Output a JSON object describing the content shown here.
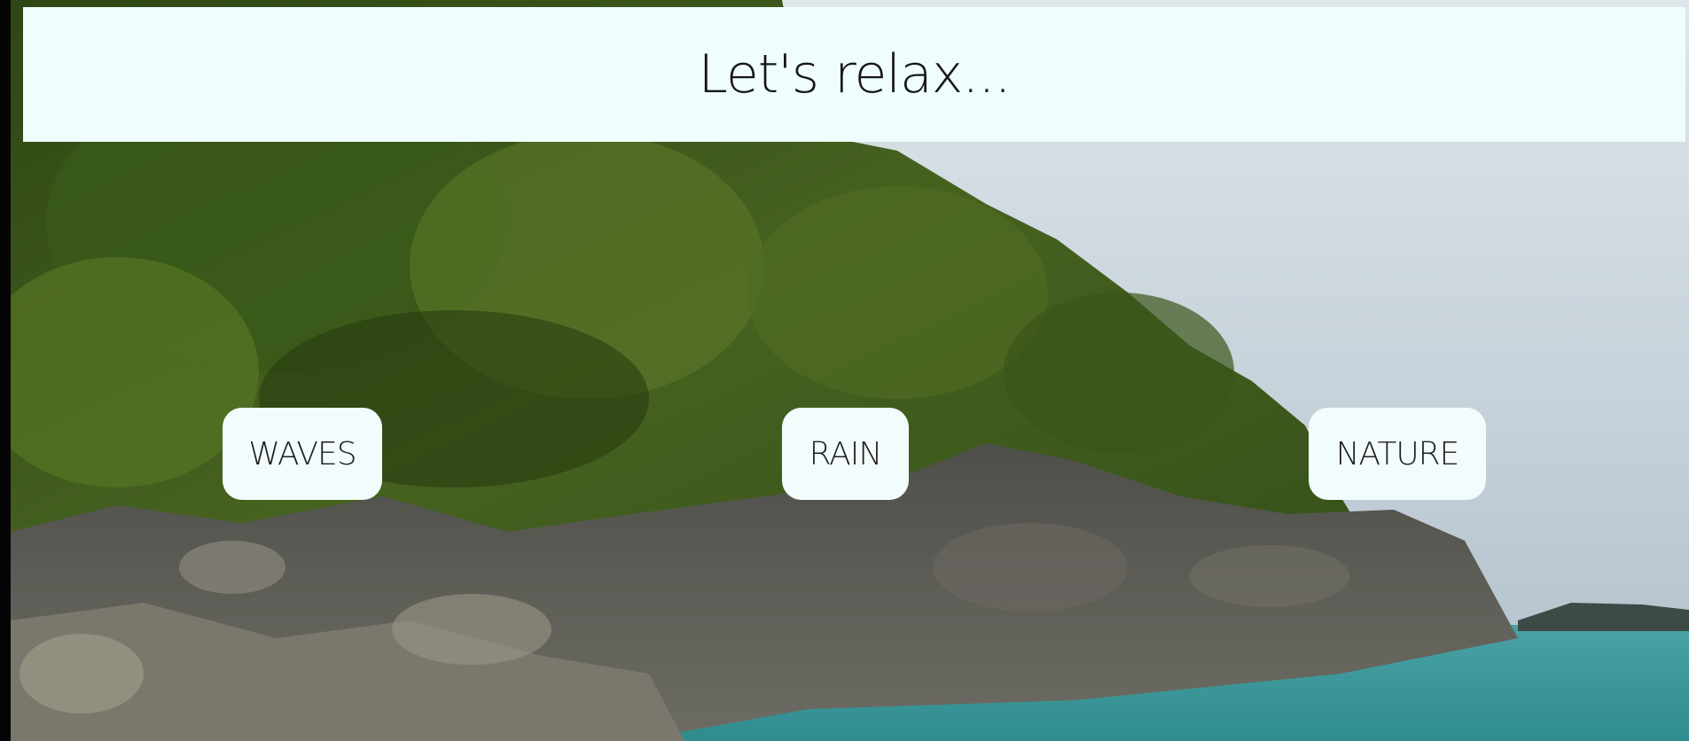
{
  "page": {
    "title": "Let's relax..."
  },
  "buttons": [
    {
      "label": "WAVES",
      "sound": "waves"
    },
    {
      "label": "RAIN",
      "sound": "rain"
    },
    {
      "label": "NATURE",
      "sound": "nature"
    }
  ],
  "background": {
    "scene": "rocky forested coastline with turquoise sea",
    "icon": "background-video"
  },
  "colors": {
    "header_bg": "#effdfd",
    "button_bg": "#f3fcfc",
    "text": "#161616",
    "sky": "#c9d4dc",
    "sea": "#3f9a9c",
    "foliage": "#3d5a1c",
    "rock": "#5a5a55"
  }
}
